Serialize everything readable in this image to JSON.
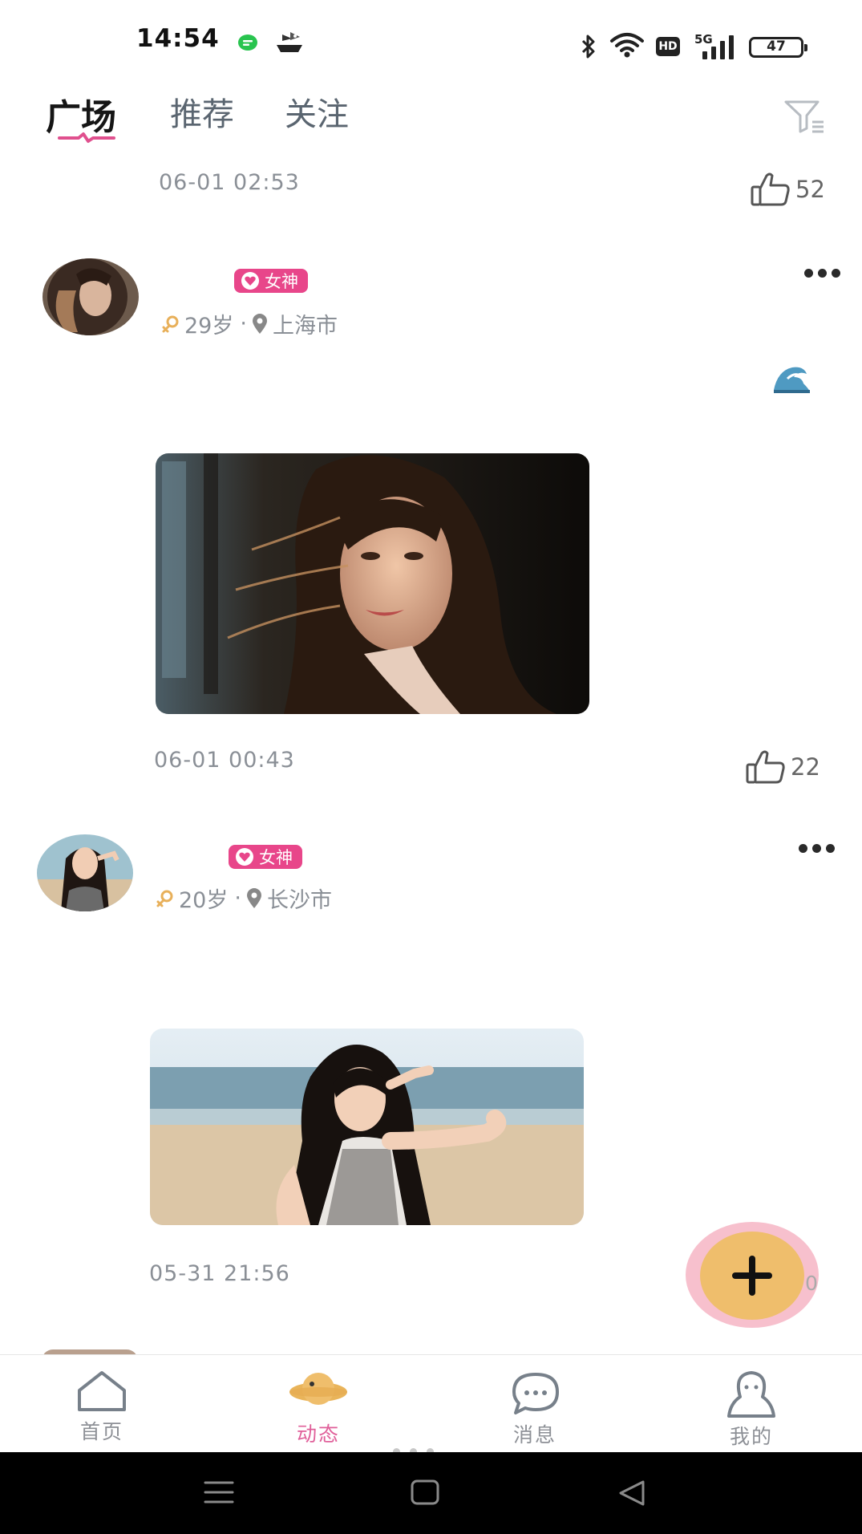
{
  "status_bar": {
    "time": "14:54",
    "battery": "47",
    "network": "5G",
    "hd": "HD"
  },
  "tabs": [
    {
      "label": "广场",
      "active": true
    },
    {
      "label": "推荐",
      "active": false
    },
    {
      "label": "关注",
      "active": false
    }
  ],
  "colors": {
    "accent_pink": "#e8468a",
    "fab_yellow": "#efbe6c",
    "fab_halo": "#f7c0cd",
    "nav_active": "#e0609a"
  },
  "feed": {
    "prev_post": {
      "time": "06-01 02:53",
      "likes": "52"
    },
    "posts": [
      {
        "badge": "女神",
        "age": "29岁",
        "separator": "·",
        "city": "上海市",
        "time": "06-01 00:43",
        "likes": "22",
        "extra_icon": "wave-emoji-icon"
      },
      {
        "badge": "女神",
        "age": "20岁",
        "separator": "·",
        "city": "长沙市",
        "time": "05-31 21:56",
        "likes": "0"
      }
    ]
  },
  "bottom_nav": [
    {
      "label": "首页",
      "icon": "home-icon",
      "active": false
    },
    {
      "label": "动态",
      "icon": "planet-icon",
      "active": true
    },
    {
      "label": "消息",
      "icon": "chat-icon",
      "active": false
    },
    {
      "label": "我的",
      "icon": "profile-icon",
      "active": false
    }
  ]
}
